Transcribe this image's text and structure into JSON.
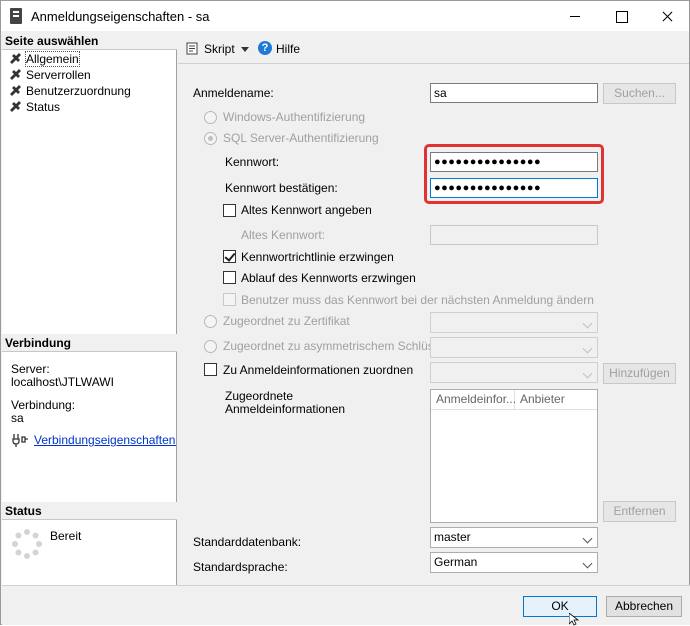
{
  "window": {
    "title": "Anmeldungseigenschaften - sa"
  },
  "left": {
    "select_page_header": "Seite auswählen",
    "pages": [
      {
        "label": "Allgemein",
        "selected": true
      },
      {
        "label": "Serverrollen"
      },
      {
        "label": "Benutzerzuordnung"
      },
      {
        "label": "Status"
      }
    ],
    "connection_header": "Verbindung",
    "server_label": "Server:",
    "server_value": "localhost\\JTLWAWI",
    "connection_label": "Verbindung:",
    "connection_value": "sa",
    "connection_link": "Verbindungseigenschaften anzeigen",
    "status_header": "Status",
    "status_value": "Bereit"
  },
  "toolbar": {
    "script_label": "Skript",
    "help_label": "Hilfe"
  },
  "form": {
    "login_name_label": "Anmeldename:",
    "login_name_value": "sa",
    "search_button": "Suchen...",
    "windows_auth": "Windows-Authentifizierung",
    "sql_auth": "SQL Server-Authentifizierung",
    "password_label": "Kennwort:",
    "password_value": "●●●●●●●●●●●●●●●",
    "confirm_label": "Kennwort bestätigen:",
    "confirm_value": "●●●●●●●●●●●●●●●",
    "old_password_check": "Altes Kennwort angeben",
    "old_password_label": "Altes Kennwort:",
    "enforce_policy": "Kennwortrichtlinie erzwingen",
    "enforce_expiration": "Ablauf des Kennworts erzwingen",
    "must_change": "Benutzer muss das Kennwort bei der nächsten Anmeldung ändern",
    "cert_mapped": "Zugeordnet zu Zertifikat",
    "asym_key_mapped": "Zugeordnet zu asymmetrischem Schlüssel",
    "map_credentials": "Zu Anmeldeinformationen zuordnen",
    "add_button": "Hinzufügen",
    "mapped_credentials_label_1": "Zugeordnete",
    "mapped_credentials_label_2": "Anmeldeinformationen",
    "grid_columns": [
      "Anmeldeinfor...",
      "Anbieter"
    ],
    "remove_button": "Entfernen",
    "default_db_label": "Standarddatenbank:",
    "default_db_value": "master",
    "default_lang_label": "Standardsprache:",
    "default_lang_value": "German"
  },
  "footer": {
    "ok": "OK",
    "cancel": "Abbrechen"
  },
  "colors": {
    "highlight": "#e03232",
    "link": "#0033cc",
    "accent": "#0078d7"
  }
}
